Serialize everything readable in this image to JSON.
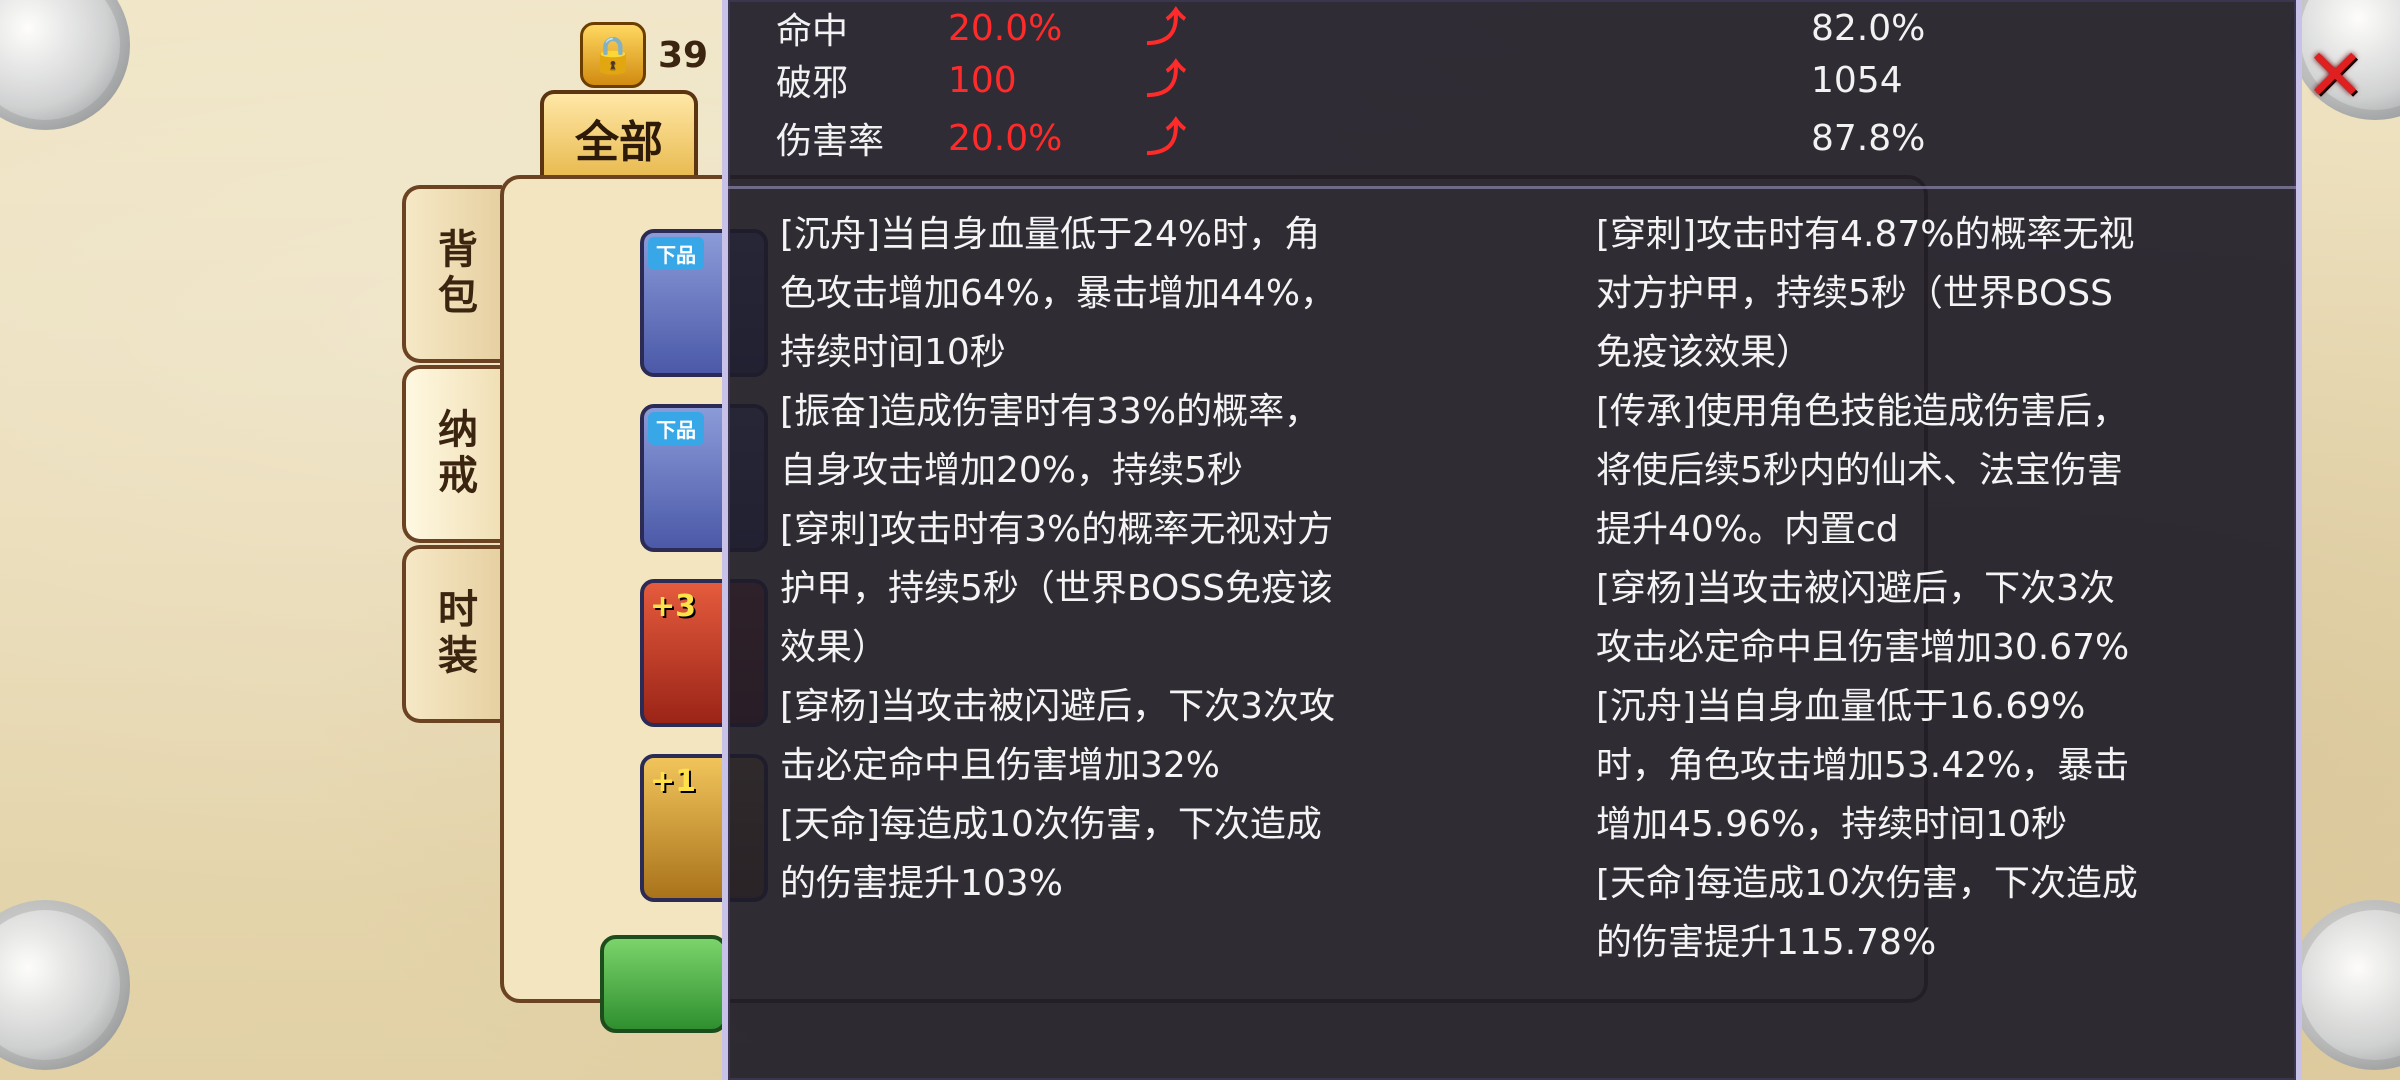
{
  "header": {
    "gold_value": "39",
    "tab_all_label": "全部"
  },
  "side_tabs": [
    {
      "label": "背包"
    },
    {
      "label": "纳戒"
    },
    {
      "label": "时装"
    }
  ],
  "inventory": {
    "slot_badge": "下品",
    "plus_badges": [
      "+3",
      "+1"
    ]
  },
  "tooltip": {
    "stats": [
      {
        "name": "命中",
        "value": "20.0%",
        "current": "82.0%"
      },
      {
        "name": "破邪",
        "value": "100",
        "current": "1054"
      },
      {
        "name": "伤害率",
        "value": "20.0%",
        "current": "87.8%"
      }
    ],
    "effects_left": [
      "[沉舟]当自身血量低于24%时，角色攻击增加64%，暴击增加44%，持续时间10秒",
      "[振奋]造成伤害时有33%的概率，自身攻击增加20%，持续5秒",
      "[穿刺]攻击时有3%的概率无视对方护甲，持续5秒（世界BOSS免疫该效果）",
      "[穿杨]当攻击被闪避后，下次3次攻击必定命中且伤害增加32%",
      "[天命]每造成10次伤害，下次造成的伤害提升103%"
    ],
    "effects_right": [
      "[穿刺]攻击时有4.87%的概率无视对方护甲，持续5秒（世界BOSS免疫该效果）",
      "[传承]使用角色技能造成伤害后，将使后续5秒内的仙术、法宝伤害提升40%。内置cd",
      "[穿杨]当攻击被闪避后，下次3次攻击必定命中且伤害增加30.67%",
      "[沉舟]当自身血量低于16.69%时，角色攻击增加53.42%，暴击增加45.96%，持续时间10秒",
      "[天命]每造成10次伤害，下次造成的伤害提升115.78%"
    ]
  },
  "colors": {
    "stat_delta": "#ff2b2b",
    "tooltip_bg": "#1e1c28"
  }
}
